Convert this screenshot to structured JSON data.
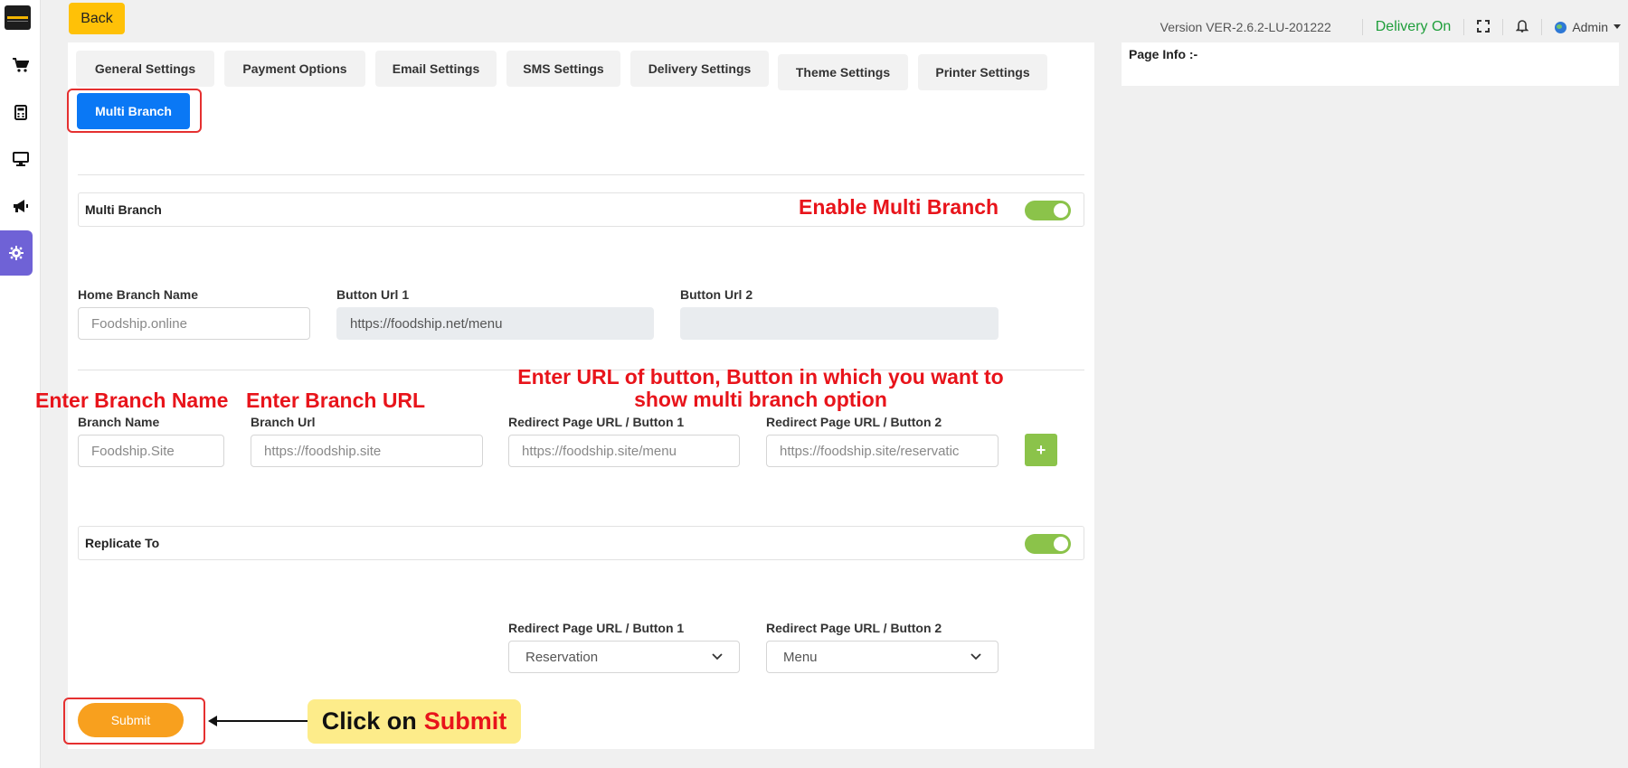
{
  "header": {
    "back_label": "Back",
    "version": "Version VER-2.6.2-LU-201222",
    "delivery_status": "Delivery On",
    "admin_label": "Admin"
  },
  "page_info": {
    "label": "Page Info :-"
  },
  "tabs": [
    "General Settings",
    "Payment Options",
    "Email Settings",
    "SMS Settings",
    "Delivery Settings",
    "Theme Settings",
    "Printer Settings",
    "Multi Branch"
  ],
  "multi_branch": {
    "label": "Multi Branch",
    "enabled": true,
    "annotation": "Enable Multi Branch"
  },
  "home_branch": {
    "name_label": "Home Branch Name",
    "name_placeholder": "Foodship.online",
    "url1_label": "Button Url 1",
    "url1_value": "https://foodship.net/menu",
    "url2_label": "Button Url 2",
    "url2_value": ""
  },
  "branch": {
    "annot_name": "Enter Branch Name",
    "annot_url": "Enter Branch URL",
    "annot_redirect": "Enter URL of button, Button in which you want to show multi branch option",
    "name_label": "Branch Name",
    "name_placeholder": "Foodship.Site",
    "url_label": "Branch Url",
    "url_placeholder": "https://foodship.site",
    "redirect1_label": "Redirect Page URL / Button 1",
    "redirect1_placeholder": "https://foodship.site/menu",
    "redirect2_label": "Redirect Page URL / Button 2",
    "redirect2_placeholder": "https://foodship.site/reservatic",
    "add_label": "+"
  },
  "replicate": {
    "label": "Replicate To",
    "enabled": true,
    "redirect1_label": "Redirect Page URL / Button 1",
    "redirect1_value": "Reservation",
    "redirect2_label": "Redirect Page URL / Button 2",
    "redirect2_value": "Menu"
  },
  "submit": {
    "label": "Submit",
    "callout_prefix": "Click on",
    "callout_action": "Submit"
  },
  "colors": {
    "accent": "#0a78f5",
    "toggle_on": "#8bc34a",
    "annotation": "#e8141b",
    "submit": "#f8a01e",
    "back": "#ffc107",
    "sidebar_active": "#6f62d6"
  }
}
